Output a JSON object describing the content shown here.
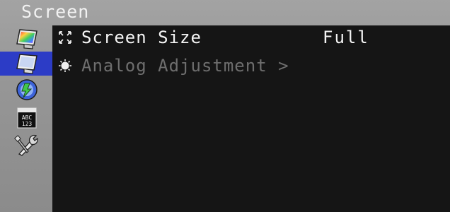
{
  "menu": {
    "title": "Screen"
  },
  "sidebar": {
    "items": [
      {
        "icon": "color-adjust-icon",
        "selected": false
      },
      {
        "icon": "screen-icon",
        "selected": true
      },
      {
        "icon": "power-manager-icon",
        "selected": false
      },
      {
        "icon": "language-icon",
        "selected": false
      },
      {
        "icon": "tools-icon",
        "selected": false
      }
    ]
  },
  "rows": [
    {
      "label": "Screen Size",
      "value": "Full",
      "icon": "expand-arrows-icon",
      "enabled": true
    },
    {
      "label": "Analog Adjustment >",
      "icon": "analog-adjust-icon",
      "enabled": false
    }
  ],
  "colors": {
    "selected_highlight": "#2c3cc6",
    "panel_background": "#151515",
    "frame_background": "#969696",
    "active_text": "#f4f4f4",
    "disabled_text": "#6e6e6e"
  }
}
